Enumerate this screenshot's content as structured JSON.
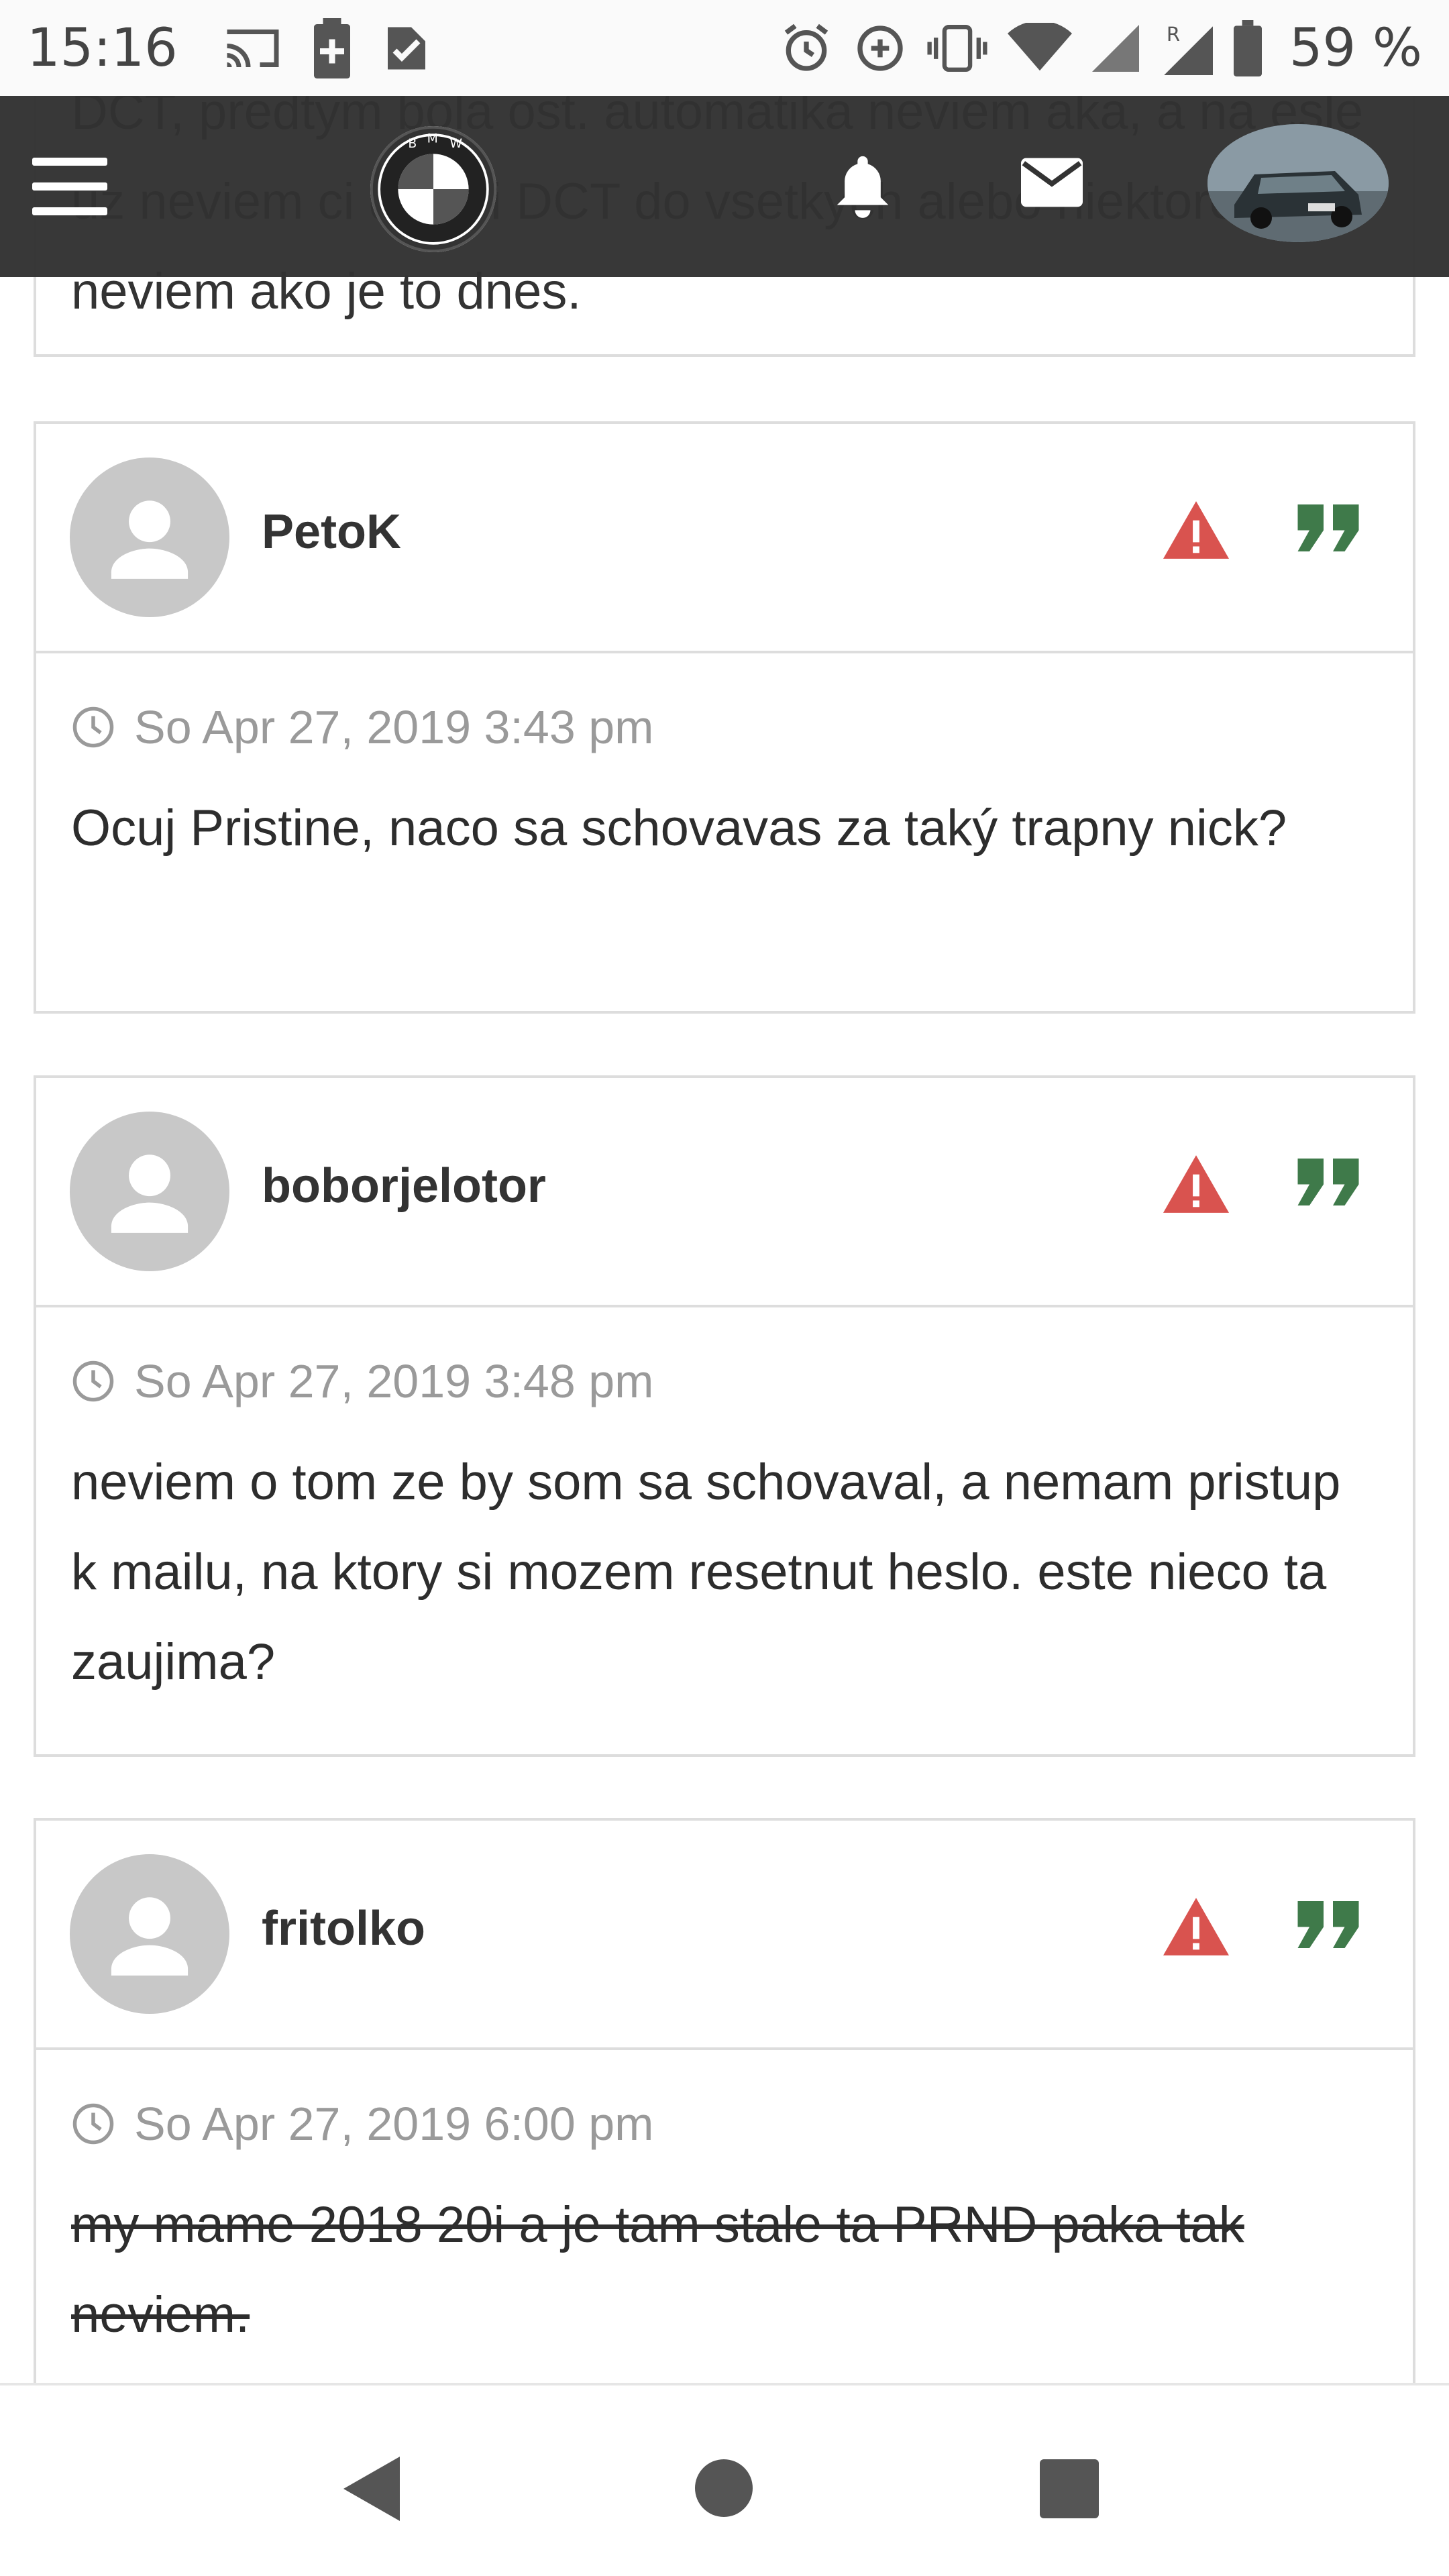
{
  "status_bar": {
    "time": "15:16",
    "battery_percent": "59 %",
    "icons": [
      "cast-icon",
      "battery-saver-icon",
      "task-check-icon",
      "alarm-icon",
      "data-saver-icon",
      "vibrate-icon",
      "wifi-icon",
      "signal-icon",
      "roaming-signal-icon",
      "battery-icon"
    ]
  },
  "header": {
    "menu_icon": "hamburger-menu-icon",
    "logo_icon": "bmw-logo-icon",
    "notifications_icon": "bell-icon",
    "messages_icon": "mail-icon",
    "profile_icon": "profile-car-avatar"
  },
  "previous_post": {
    "text": "DCT, predtym bola ost. automatika neviem aka, a na esle uz neviem ci davali DCT do vsetkych alebo niektore. a neviem ako je to dnes."
  },
  "posts": [
    {
      "username": "PetoK",
      "datetime": "So Apr 27, 2019 3:43 pm",
      "message": "Ocuj Pristine, naco sa schovavas za taký trapny nick?"
    },
    {
      "username": "boborjelotor",
      "datetime": "So Apr 27, 2019 3:48 pm",
      "message": "neviem o tom ze by som sa schovaval, a nemam pristup k mailu, na ktory si mozem resetnut heslo. este nieco ta zaujima?"
    },
    {
      "username": "fritolko",
      "datetime": "So Apr 27, 2019 6:00 pm",
      "message": "my mame 2018 20i a je tam stale ta PRND paka tak neviem."
    }
  ],
  "nav": {
    "back_icon": "back-triangle-icon",
    "home_icon": "home-circle-icon",
    "recents_icon": "recents-square-icon"
  },
  "colors": {
    "header_bg": "#323232",
    "warn": "#d9534f",
    "quote": "#3f7a4a",
    "border": "#dddddd"
  }
}
